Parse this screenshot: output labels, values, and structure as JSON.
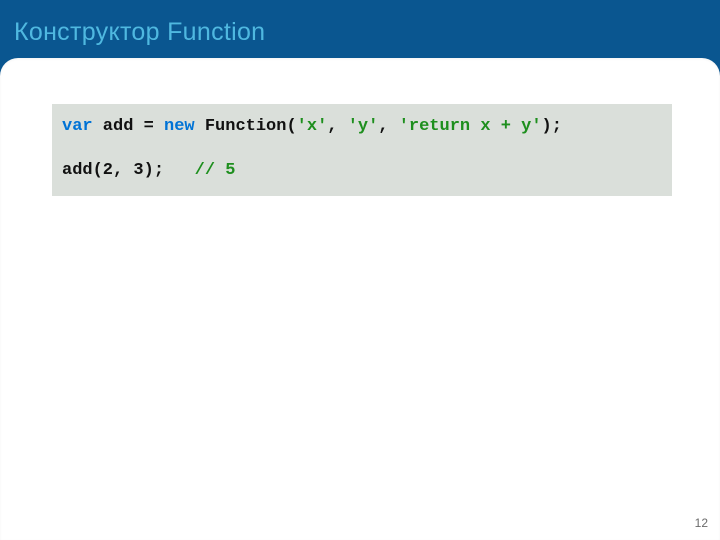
{
  "slide": {
    "title": "Конструктор Function",
    "page_number": "12"
  },
  "code": {
    "line1": {
      "k_var": "var",
      "p1": " add = ",
      "k_new": "new",
      "p2": " Function(",
      "s1": "'x'",
      "p3": ", ",
      "s2": "'y'",
      "p4": ", ",
      "s3": "'return x + y'",
      "p5": ");"
    },
    "blank": " ",
    "line3": {
      "p1": "add(2, 3);   ",
      "comment": "// 5"
    }
  }
}
